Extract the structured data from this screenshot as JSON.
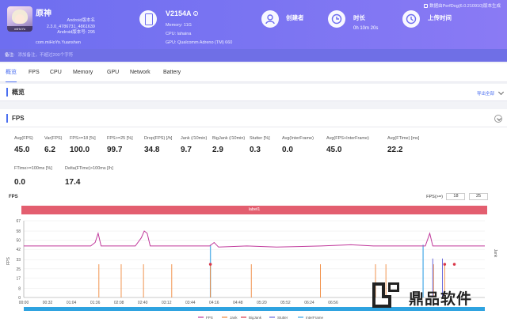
{
  "header": {
    "app_name": "原神",
    "android_version_label": "Android版本名",
    "android_version_name": "2.3.0_4786731_4861639",
    "android_version_code": "Android版本号: 295",
    "package": "com.miHoYo.Yuanshen",
    "app_icon_tag": "miHoYo",
    "top_right": "数据由PerfDog(6.0.210910)版本生成",
    "device": {
      "name": "V2154A",
      "memory": "Memory: 11G",
      "cpu": "CPU: lahaina",
      "gpu": "GPU: Qualcomm Adreno (TM) 660"
    },
    "creator_label": "创建者",
    "duration_label": "时长",
    "duration_value": "0h 10m 20s",
    "upload_label": "上传时间",
    "note_label": "备注:",
    "note_placeholder": "添加备注，不超过200个字符"
  },
  "tabs": [
    "概览",
    "FPS",
    "CPU",
    "Memory",
    "GPU",
    "Network",
    "Battery"
  ],
  "active_tab": "概览",
  "overview": {
    "title": "概览",
    "export": "导出全部"
  },
  "fps_section": {
    "title": "FPS",
    "metrics": [
      {
        "label": "Avg(FPS)",
        "value": "45.0"
      },
      {
        "label": "Var(FPS)",
        "value": "6.2"
      },
      {
        "label": "FPS>=18 [%]",
        "value": "100.0"
      },
      {
        "label": "FPS>=25 [%]",
        "value": "99.7"
      },
      {
        "label": "Drop(FPS) [/h]",
        "value": "34.8"
      },
      {
        "label": "Jank (/10min)",
        "value": "9.7"
      },
      {
        "label": "BigJank (/10min)",
        "value": "2.9"
      },
      {
        "label": "Stutter [%]",
        "value": "0.3"
      },
      {
        "label": "Avg(InterFrame)",
        "value": "0.0"
      },
      {
        "label": "Avg(FPS+InterFrame)",
        "value": "45.0"
      },
      {
        "label": "Avg(FTime) [ms]",
        "value": "22.2"
      },
      {
        "label": "FTime>=100ms [%]",
        "value": "0.0"
      },
      {
        "label": "Delta(FTime)>100ms [/h]",
        "value": "17.4"
      }
    ],
    "filter_label": "FPS(>=)",
    "filter_low": "18",
    "filter_high": "25",
    "label_bar": "label1"
  },
  "chart_data": {
    "type": "line",
    "title": "FPS",
    "ylabel_left": "FPS",
    "ylabel_right": "Jank",
    "y_ticks": [
      67,
      58,
      50,
      42,
      33,
      25,
      17,
      8,
      0
    ],
    "ylim": [
      0,
      67
    ],
    "x_ticks": [
      "00:00",
      "00:32",
      "01:04",
      "01:36",
      "02:08",
      "02:40",
      "03:12",
      "03:44",
      "04:16",
      "04:48",
      "05:20",
      "05:52",
      "06:24",
      "06:56"
    ],
    "x_range_seconds": [
      0,
      620
    ],
    "series": [
      {
        "name": "FPS",
        "color": "#c0399b"
      },
      {
        "name": "Jank",
        "color": "#f0883c"
      },
      {
        "name": "BigJank",
        "color": "#d9384a"
      },
      {
        "name": "Stutter",
        "color": "#6a6adc"
      },
      {
        "name": "InterFrame",
        "color": "#3aa5e6"
      }
    ],
    "fps_baseline": 45,
    "fps_points": [
      [
        0,
        45
      ],
      [
        40,
        45
      ],
      [
        90,
        45
      ],
      [
        96,
        48
      ],
      [
        100,
        56
      ],
      [
        104,
        45
      ],
      [
        150,
        45
      ],
      [
        158,
        52
      ],
      [
        162,
        58
      ],
      [
        166,
        56
      ],
      [
        170,
        45
      ],
      [
        250,
        45
      ],
      [
        256,
        48
      ],
      [
        262,
        44
      ],
      [
        300,
        45
      ],
      [
        340,
        44
      ],
      [
        400,
        45
      ],
      [
        440,
        46
      ],
      [
        470,
        45
      ],
      [
        540,
        45
      ],
      [
        546,
        56
      ],
      [
        550,
        45
      ],
      [
        600,
        45
      ],
      [
        620,
        45
      ]
    ],
    "jank_times": [
      101,
      131,
      161,
      199,
      251,
      306,
      399,
      473,
      487,
      551,
      566
    ],
    "bigjank_times": [
      251,
      566,
      579
    ],
    "stutter_times": [
      550,
      563
    ],
    "interframe_times": [
      251,
      537
    ]
  }
}
